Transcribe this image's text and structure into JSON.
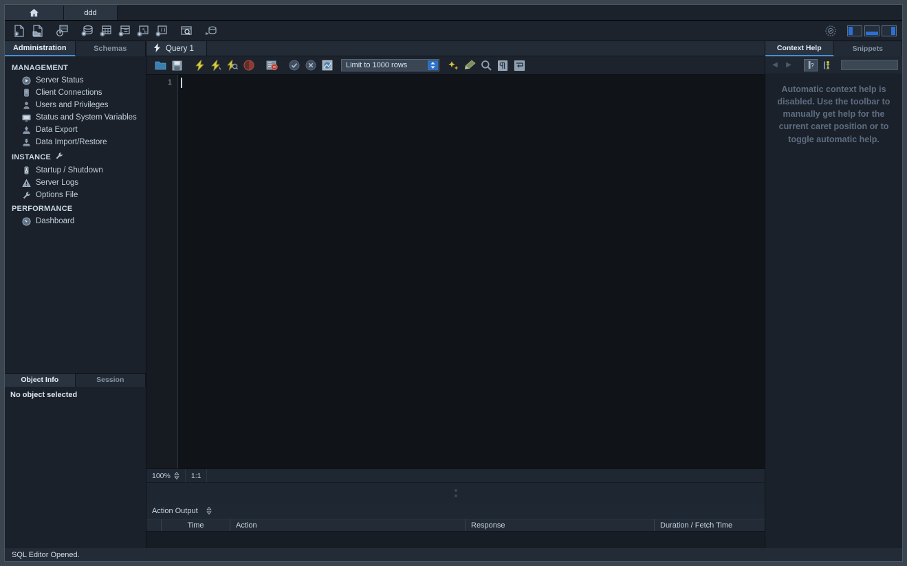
{
  "window_tabs": [
    {
      "name": "home-tab",
      "label": "",
      "icon": "home-icon",
      "active": false
    },
    {
      "name": "connection-tab",
      "label": "ddd",
      "icon": "",
      "active": true
    }
  ],
  "main_toolbar": {
    "buttons": [
      {
        "name": "new-sql-tab-button",
        "icon": "new-file-icon",
        "title": "New SQL Tab"
      },
      {
        "name": "open-sql-script-button",
        "icon": "open-folder-file-icon",
        "title": "Open SQL Script"
      },
      {
        "name": "save-sql-script-button",
        "icon": "save-script-icon",
        "title": "Save Script"
      },
      {
        "name": "create-schema-button",
        "icon": "database-plus-icon",
        "title": "Create Schema"
      },
      {
        "name": "create-table-button",
        "icon": "table-plus-icon",
        "title": "Create Table"
      },
      {
        "name": "create-view-button",
        "icon": "view-plus-icon",
        "title": "Create View"
      },
      {
        "name": "create-procedure-button",
        "icon": "procedure-plus-icon",
        "title": "Create Procedure"
      },
      {
        "name": "create-function-button",
        "icon": "function-plus-icon",
        "title": "Create Function"
      },
      {
        "name": "search-data-button",
        "icon": "magnifier-table-icon",
        "title": "Search Data"
      },
      {
        "name": "reconnect-server-button",
        "icon": "reconnect-icon",
        "title": "Reconnect to Server"
      }
    ],
    "right_buttons": [
      {
        "name": "mysql-logo-button",
        "icon": "dolphin-badge-icon"
      },
      {
        "name": "toggle-sidebar-button",
        "icon": "panel-left-icon"
      },
      {
        "name": "toggle-output-button",
        "icon": "panel-bottom-icon"
      },
      {
        "name": "toggle-secondary-sidebar-button",
        "icon": "panel-right-icon"
      }
    ]
  },
  "sidebar": {
    "tabs": [
      {
        "name": "tab-administration",
        "label": "Administration",
        "active": true
      },
      {
        "name": "tab-schemas",
        "label": "Schemas",
        "active": false
      }
    ],
    "groups": [
      {
        "title": "MANAGEMENT",
        "icon": "",
        "items": [
          {
            "label": "Server Status",
            "icon": "play-circle-icon"
          },
          {
            "label": "Client Connections",
            "icon": "server-rack-icon"
          },
          {
            "label": "Users and Privileges",
            "icon": "user-icon"
          },
          {
            "label": "Status and System Variables",
            "icon": "monitor-icon"
          },
          {
            "label": "Data Export",
            "icon": "export-up-icon"
          },
          {
            "label": "Data Import/Restore",
            "icon": "import-down-icon"
          }
        ]
      },
      {
        "title": "INSTANCE",
        "icon": "wrench-icon",
        "items": [
          {
            "label": "Startup / Shutdown",
            "icon": "power-server-icon"
          },
          {
            "label": "Server Logs",
            "icon": "warning-triangle-icon"
          },
          {
            "label": "Options File",
            "icon": "wrench-icon"
          }
        ]
      },
      {
        "title": "PERFORMANCE",
        "icon": "",
        "items": [
          {
            "label": "Dashboard",
            "icon": "gauge-icon"
          }
        ]
      }
    ],
    "object_tabs": [
      {
        "name": "tab-object-info",
        "label": "Object Info",
        "active": true
      },
      {
        "name": "tab-session",
        "label": "Session",
        "active": false
      }
    ],
    "object_info_text": "No object selected"
  },
  "editor": {
    "tabs": [
      {
        "name": "query-tab-1",
        "label": "Query 1",
        "icon": "lightning-icon",
        "active": true
      }
    ],
    "toolbar": {
      "buttons": [
        {
          "name": "open-script-button",
          "icon": "folder-icon"
        },
        {
          "name": "save-script-button",
          "icon": "floppy-disk-icon"
        },
        {
          "name": "execute-statement-button",
          "icon": "lightning-bolt-icon"
        },
        {
          "name": "execute-current-statement-button",
          "icon": "lightning-cursor-icon"
        },
        {
          "name": "explain-statement-button",
          "icon": "lightning-magnifier-icon"
        },
        {
          "name": "stop-execution-button",
          "icon": "stop-circle-icon"
        },
        {
          "name": "toggle-stop-on-error-button",
          "icon": "stop-on-error-icon"
        },
        {
          "name": "commit-button",
          "icon": "commit-check-icon"
        },
        {
          "name": "rollback-button",
          "icon": "rollback-cross-icon"
        },
        {
          "name": "toggle-autocommit-button",
          "icon": "autocommit-icon"
        }
      ],
      "limit_select": {
        "name": "row-limit-select",
        "value": "Limit to 1000 rows"
      },
      "right_buttons": [
        {
          "name": "beautify-query-button",
          "icon": "magic-wand-icon"
        },
        {
          "name": "toggle-autocomplete-button",
          "icon": "broom-icon"
        },
        {
          "name": "find-button",
          "icon": "magnifier-icon"
        },
        {
          "name": "toggle-invisible-chars-button",
          "icon": "paragraph-mark-icon"
        },
        {
          "name": "wrap-lines-button",
          "icon": "wrap-arrow-icon"
        }
      ]
    },
    "line_numbers": [
      "1"
    ],
    "content": "",
    "status": {
      "zoom": "100%",
      "caret_position": "1:1"
    }
  },
  "output": {
    "selector_label": "Action Output",
    "columns": [
      "",
      "Time",
      "Action",
      "Response",
      "Duration / Fetch Time"
    ],
    "rows": []
  },
  "context_help": {
    "tabs": [
      {
        "name": "tab-context-help",
        "label": "Context Help",
        "active": true
      },
      {
        "name": "tab-snippets",
        "label": "Snippets",
        "active": false
      }
    ],
    "toolbar": [
      {
        "name": "help-back-button",
        "icon": "arrow-left-icon"
      },
      {
        "name": "help-forward-button",
        "icon": "arrow-right-icon"
      },
      {
        "name": "manual-help-button",
        "icon": "context-help-icon"
      },
      {
        "name": "toggle-automatic-help-button",
        "icon": "auto-help-person-icon"
      }
    ],
    "search_value": "",
    "message": "Automatic context help is disabled. Use the toolbar to manually get help for the current caret position or to toggle automatic help."
  },
  "status_bar": {
    "message": "SQL Editor Opened."
  },
  "colors": {
    "accent_blue": "#2f6fc4",
    "panel_bg": "#1a212a",
    "editor_bg": "#101317",
    "text": "#c8d4e2"
  }
}
